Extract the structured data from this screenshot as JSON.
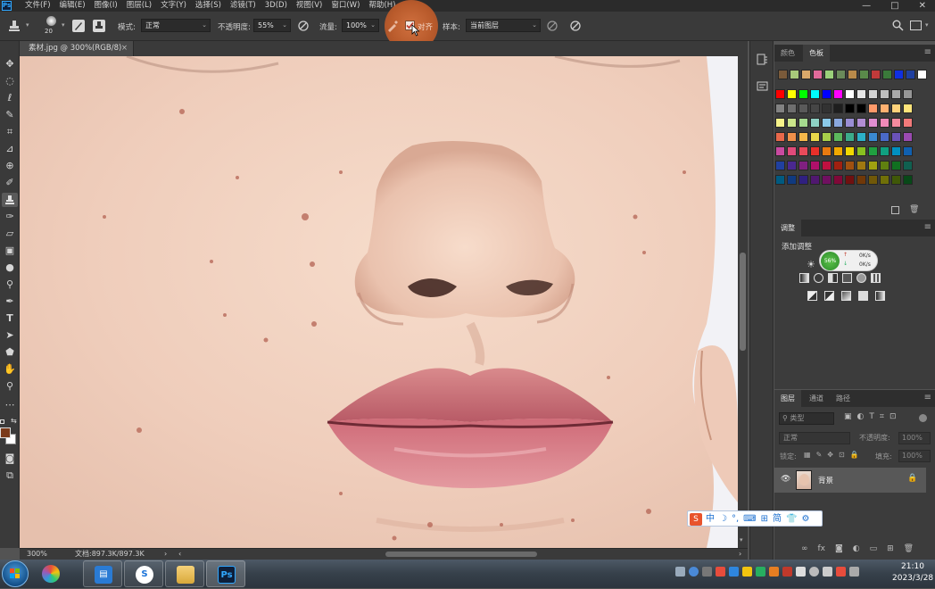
{
  "app": {
    "logo": "Ps"
  },
  "menu": [
    "文件(F)",
    "编辑(E)",
    "图像(I)",
    "图层(L)",
    "文字(Y)",
    "选择(S)",
    "滤镜(T)",
    "3D(D)",
    "视图(V)",
    "窗口(W)",
    "帮助(H)"
  ],
  "window_controls": {
    "minimize": "—",
    "restore": "□",
    "close": "✕"
  },
  "options": {
    "brush_size": "20",
    "mode_label": "模式:",
    "mode_value": "正常",
    "opacity_label": "不透明度:",
    "opacity_value": "55%",
    "flow_label": "流量:",
    "flow_value": "100%",
    "aligned_label": "对齐",
    "aligned_checked": true,
    "sample_label": "样本:",
    "sample_value": "当前图层"
  },
  "document_tab": {
    "title": "素材.jpg @ 300%(RGB/8)",
    "close": "×"
  },
  "status": {
    "zoom": "300%",
    "doc_info": "文档:897.3K/897.3K"
  },
  "swatches_panel": {
    "tabs": [
      "颜色",
      "色板"
    ],
    "active_tab": "色板",
    "recent": [
      "#7a5a3a",
      "#a7c97a",
      "#d9a86a",
      "#e06a9a",
      "#9ad07a",
      "#6a8a5a",
      "#b88a4a",
      "#5a8a4a",
      "#c03a3a",
      "#3a7a3a",
      "#1030e0",
      "#2040a0",
      "#ffffff"
    ],
    "rows": [
      [
        "#ff0000",
        "#ffff00",
        "#00ff00",
        "#00ffff",
        "#0000ff",
        "#ff00ff",
        "#ffffff",
        "#e6e6e6",
        "#d2d2d2",
        "#bebebe",
        "#aaaaaa",
        "#969696"
      ],
      [
        "#828282",
        "#6e6e6e",
        "#5a5a5a",
        "#464646",
        "#323232",
        "#1e1e1e",
        "#000000",
        "#000000",
        "#ff9a6a",
        "#ffb070",
        "#ffd27a",
        "#ffe47a"
      ],
      [
        "#f7f38a",
        "#cbe58a",
        "#a5d98e",
        "#8ed1c4",
        "#8bc9e8",
        "#8aa8de",
        "#9a8ed4",
        "#b28ed4",
        "#e08ed0",
        "#f08ab8",
        "#f58a9e",
        "#f27a7a"
      ],
      [
        "#e8684a",
        "#f0904a",
        "#f5b84a",
        "#e8d84a",
        "#a8cf4a",
        "#5cb85c",
        "#3cab8a",
        "#2cb0c8",
        "#3a8ad0",
        "#4a6ac8",
        "#6a52b8",
        "#9a4ab0"
      ],
      [
        "#c84aa0",
        "#e04a7a",
        "#e84a5a",
        "#e8302a",
        "#e87a10",
        "#f0a800",
        "#f0d800",
        "#88c020",
        "#20a040",
        "#10a080",
        "#0090c0",
        "#1060b0"
      ],
      [
        "#2040a0",
        "#4a2890",
        "#802080",
        "#b0106a",
        "#c01040",
        "#a02010",
        "#a05010",
        "#a07810",
        "#a0a010",
        "#608010",
        "#107020",
        "#106050"
      ],
      [
        "#005a80",
        "#103a80",
        "#302080",
        "#501870",
        "#701060",
        "#800838",
        "#701010",
        "#703808",
        "#705808",
        "#707008",
        "#405808",
        "#084818"
      ]
    ]
  },
  "adjustments_panel": {
    "tab": "调整",
    "add_label": "添加调整",
    "net_percent": "56%",
    "up_speed": "0K/s",
    "down_speed": "0K/s"
  },
  "layers_panel": {
    "tabs": [
      "图层",
      "通道",
      "路径"
    ],
    "active_tab": "图层",
    "filter_placeholder": "类型",
    "blend_mode": "正常",
    "opacity_label": "不透明度:",
    "opacity_value": "100%",
    "lock_label": "锁定:",
    "fill_label": "填充:",
    "fill_value": "100%",
    "layers": [
      {
        "name": "背景",
        "visible": true,
        "locked": true
      }
    ]
  },
  "ime": {
    "logo": "S",
    "items": [
      "中",
      "☽",
      "°,",
      "⌨",
      "⊞",
      "简",
      "👕",
      "⚙"
    ]
  },
  "taskbar": {
    "clock_time": "21:10",
    "clock_date": "2023/3/28",
    "ps_label": "Ps"
  }
}
